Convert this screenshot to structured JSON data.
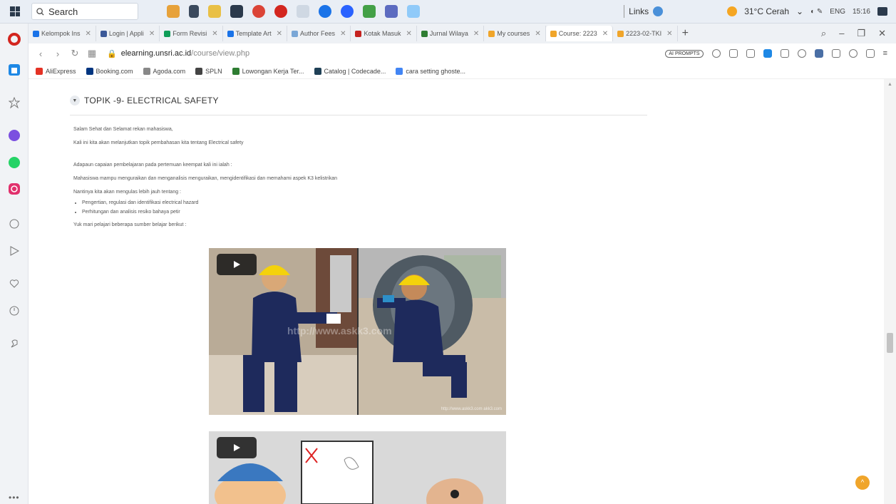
{
  "taskbar": {
    "search_placeholder": "Search",
    "links_label": "Links",
    "weather": "31°C Cerah",
    "lang": "ENG",
    "time": "15:16"
  },
  "tabs": [
    {
      "label": "Kelompok Ins",
      "color": "#1a73e8"
    },
    {
      "label": "Login | Appli",
      "color": "#3b5998"
    },
    {
      "label": "Form Revisi",
      "color": "#0f9d58"
    },
    {
      "label": "Template Art",
      "color": "#1a73e8"
    },
    {
      "label": "Author Fees",
      "color": "#7aa7d6"
    },
    {
      "label": "Kotak Masuk",
      "color": "#c5221f"
    },
    {
      "label": "Jurnal Wilaya",
      "color": "#2e7d32"
    },
    {
      "label": "My courses",
      "color": "#f0a52a"
    },
    {
      "label": "Course: 2223",
      "color": "#f0a52a",
      "active": true
    },
    {
      "label": "2223-02-TKI",
      "color": "#f0a52a"
    }
  ],
  "address": {
    "host": "elearning.unsri.ac.id",
    "path": "/course/view.php",
    "ai_label": "AI PROMPTS"
  },
  "bookmarks": [
    {
      "label": "AliExpress",
      "color": "#e43225"
    },
    {
      "label": "Booking.com",
      "color": "#003580"
    },
    {
      "label": "Agoda.com",
      "color": "#888888"
    },
    {
      "label": "SPLN",
      "color": "#444444"
    },
    {
      "label": "Lowongan Kerja Ter...",
      "color": "#2e7d32"
    },
    {
      "label": "Catalog | Codecade...",
      "color": "#1f4056"
    },
    {
      "label": "cara setting ghoste...",
      "color": "#4285f4"
    }
  ],
  "section": {
    "title": "TOPIK -9- ELECTRICAL SAFETY"
  },
  "content": {
    "greeting": "Salam Sehat dan Selamat rekan mahasiswa,",
    "intro": "Kali ini kita akan melanjutkan topik pembahasan kita tentang Electrical safety",
    "goal_intro": "Adapaun capaian pembelajaran pada pertemuan keempat kali ini ialah :",
    "goal": "Mahasiswa mampu menguraikan dan menganalisis menguraikan, mengidentifikasi dan memahami aspek K3 kelistrikan",
    "detail_intro": "Nantinya kita akan mengulas lebih jauh tentang :",
    "points": [
      "Pengertian, regulasi dan identifikasi electrical hazard",
      "Perhitungan dan analisis resiko bahaya petir"
    ],
    "closing": "Yuk mari pelajari beberapa sumber belajar berikut :"
  },
  "videos": {
    "v1_watermark": "http://www.askk3.com",
    "v1_corner": "http://www.askk3.com\nakk3.com"
  }
}
